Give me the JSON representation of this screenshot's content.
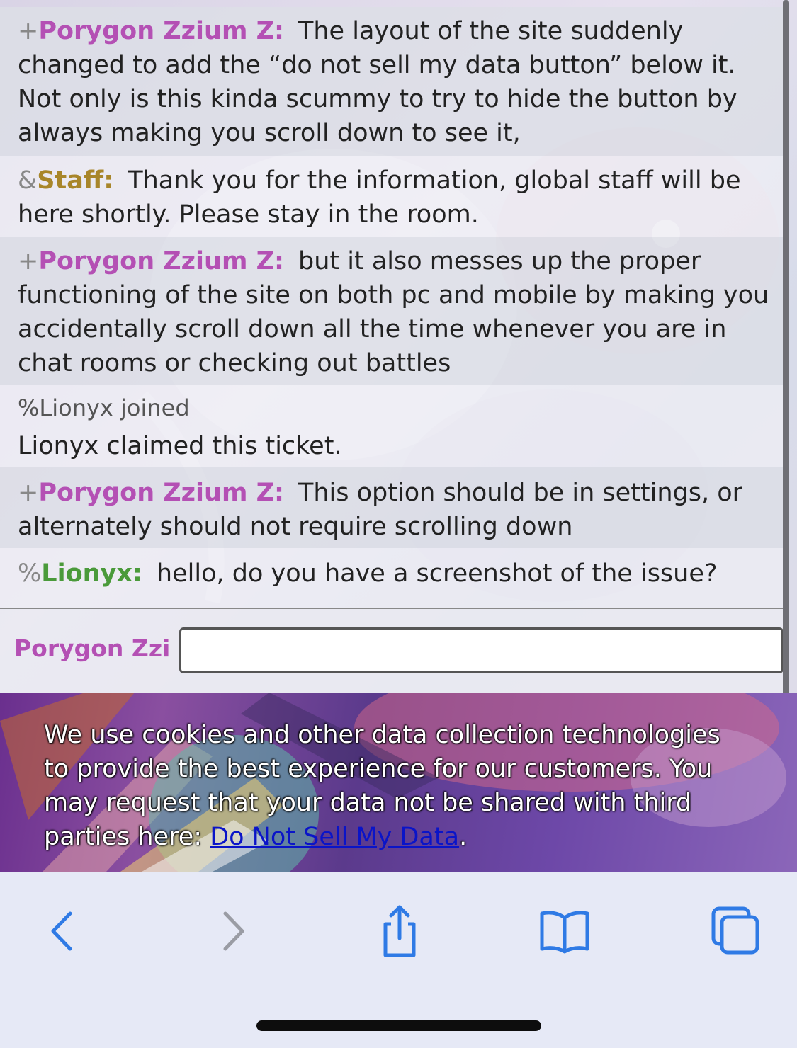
{
  "messages": [
    {
      "rank": "+",
      "user": "Porygon Zzium Z:",
      "text": "The layout of the site suddenly changed to add the “do not sell my data button” below it. Not only is this kinda scummy to try to hide the button by always making you scroll down to see it,"
    },
    {
      "rank": "&",
      "user": "Staff:",
      "text": "Thank you for the information, global staff will be here shortly. Please stay in the room."
    },
    {
      "rank": "+",
      "user": "Porygon Zzium Z:",
      "text": "but it also messes up the proper functioning of the site on both pc and mobile by making you accidentally scroll down all the time whenever you are in chat rooms or checking out battles"
    },
    {
      "notice": "%Lionyx joined"
    },
    {
      "plain": "Lionyx claimed this ticket."
    },
    {
      "rank": "+",
      "user": "Porygon Zzium Z:",
      "text": "This option should be in settings, or alternately should not require scrolling down"
    },
    {
      "rank": "%",
      "user": "Lionyx:",
      "text": "hello, do you have a screenshot of the issue?"
    }
  ],
  "compose": {
    "name": "Porygon Zzi",
    "value": ""
  },
  "cookie_banner": {
    "text": "We use cookies and other data collection technologies to provide the best experience for our customers. You may request that your data not be shared with third parties here: ",
    "link": "Do Not Sell My Data",
    "end": "."
  },
  "colors": {
    "porygon": "#b450b4",
    "staff": "#a8862a",
    "lionyx": "#4a9a3a",
    "link": "#0a14c8",
    "toolbar_icon": "#2f7ae5"
  },
  "toolbar": {
    "icons": [
      "back-icon",
      "forward-icon",
      "share-icon",
      "bookmarks-icon",
      "tabs-icon"
    ]
  }
}
